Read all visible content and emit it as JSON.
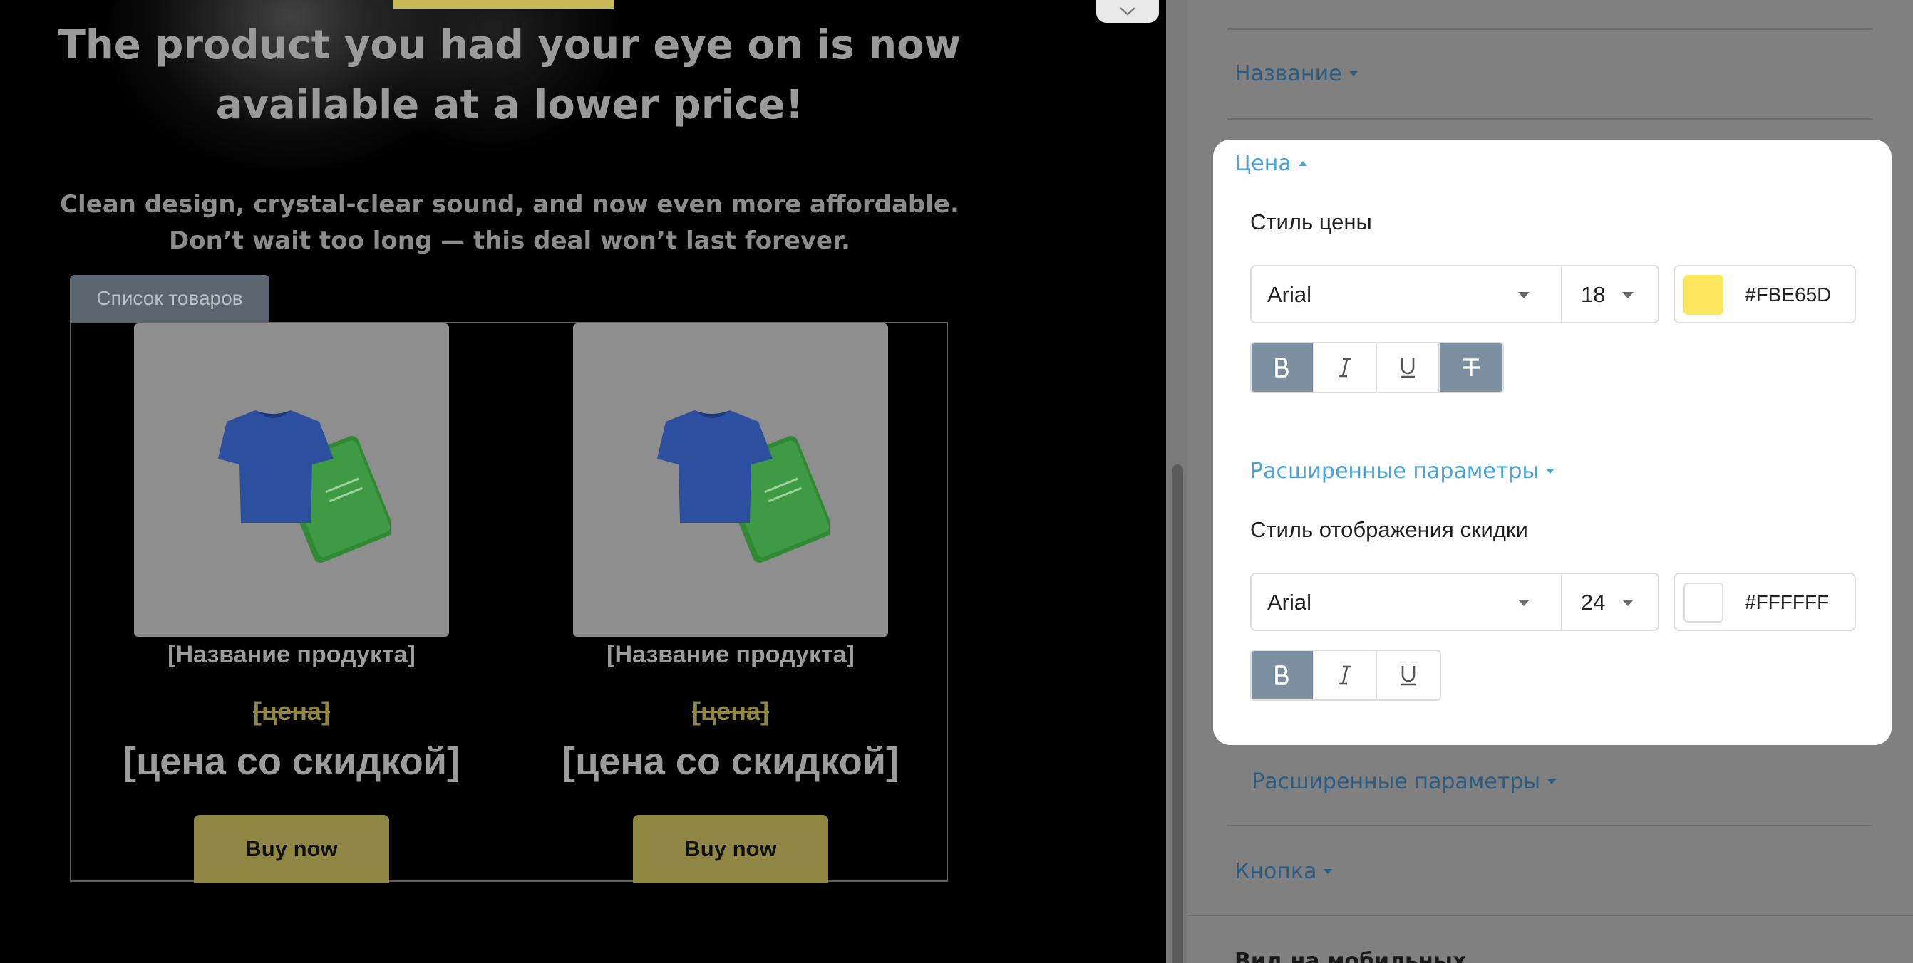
{
  "preview": {
    "hero_title": "The product you had your eye on is now available at a lower price!",
    "hero_subtitle": "Clean design, crystal-clear sound, and now even more affordable. Don’t wait too long — this deal won’t last forever.",
    "products_tab": "Список товаров",
    "products": [
      {
        "name": "[Название продукта]",
        "price": "[цена]",
        "discount_price": "[цена со скидкой]",
        "buy_label": "Buy now"
      },
      {
        "name": "[Название продукта]",
        "price": "[цена]",
        "discount_price": "[цена со скидкой]",
        "buy_label": "Buy now"
      }
    ]
  },
  "settings": {
    "name_section": "Название",
    "price_section": "Цена",
    "price_style": {
      "label": "Стиль цены",
      "font": "Arial",
      "size": "18",
      "color_hex": "#FBE65D",
      "color": "#FBE65D"
    },
    "advanced_link": "Расширенные параметры",
    "discount_style": {
      "label": "Стиль отображения скидки",
      "font": "Arial",
      "size": "24",
      "color_hex": "#FFFFFF",
      "color": "#FFFFFF"
    },
    "advanced_link_2": "Расширенные параметры",
    "button_section": "Кнопка",
    "mobile_section": "Вид на мобильных"
  }
}
